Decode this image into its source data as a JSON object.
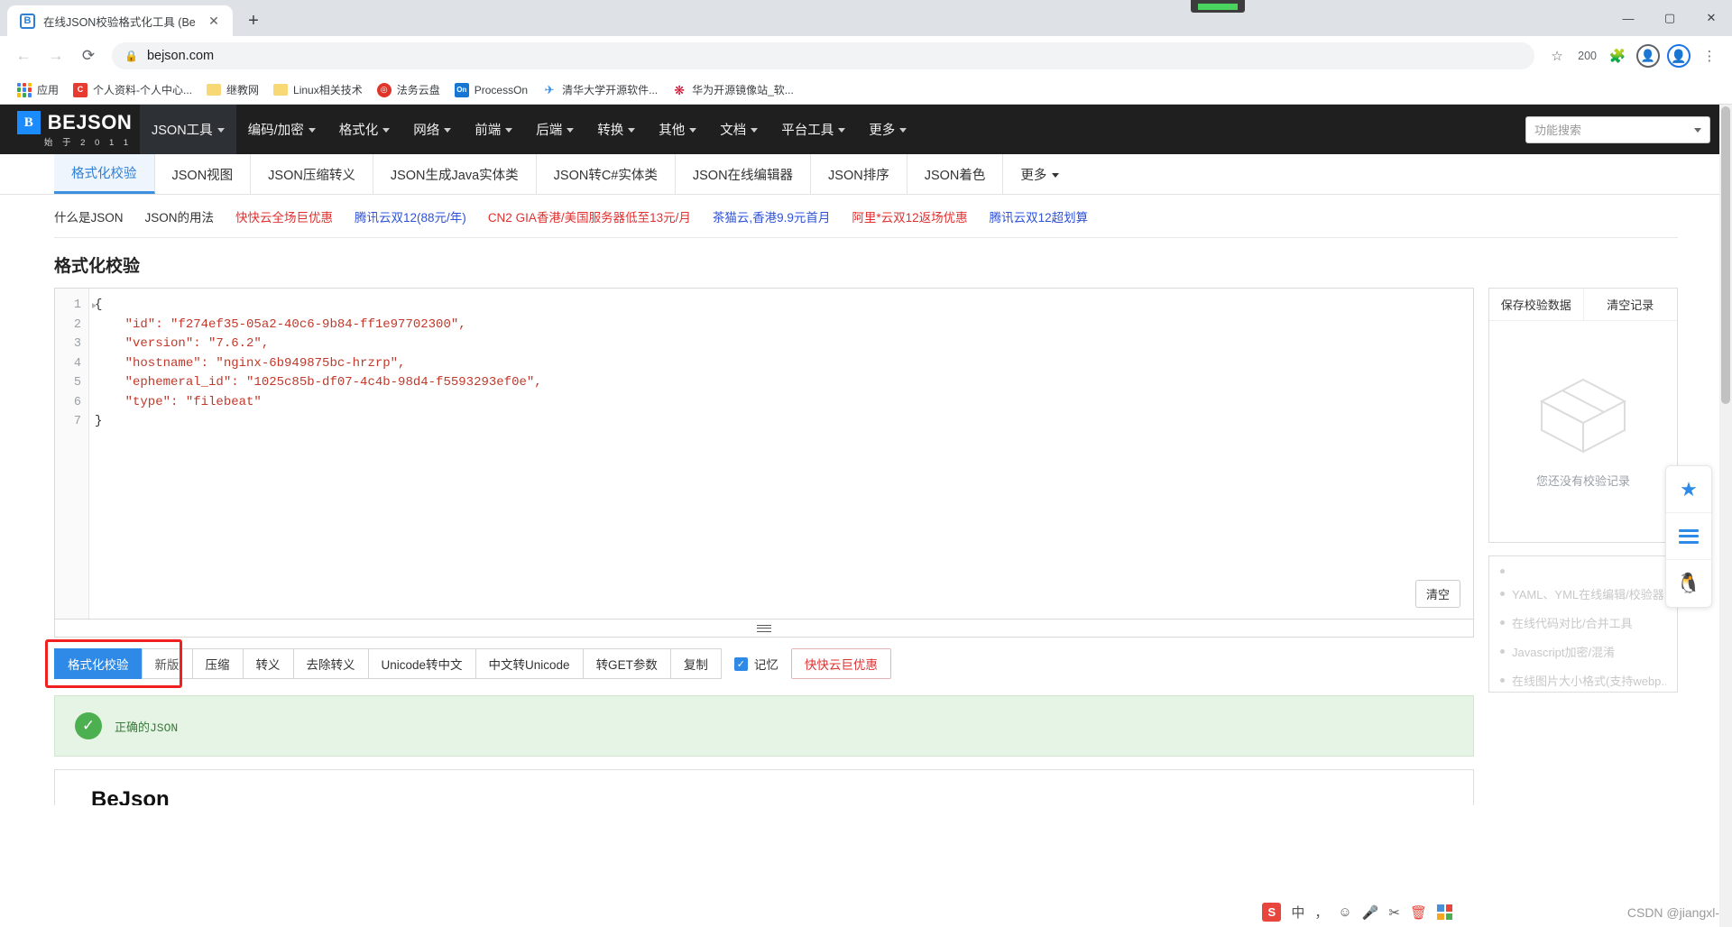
{
  "browser": {
    "tab": {
      "favicon_letter": "B",
      "title": "在线JSON校验格式化工具 (Be",
      "close_glyph": "✕"
    },
    "new_tab_glyph": "+",
    "nav": {
      "back_glyph": "←",
      "forward_glyph": "→",
      "reload_glyph": "⟳"
    },
    "omnibox": {
      "lock_glyph": "🔒",
      "url": "bejson.com",
      "star_glyph": "☆"
    },
    "extension_count": "200",
    "puzzle_glyph": "🧩",
    "profile_glyph": "👤",
    "menu_glyph": "⋮",
    "window_controls": {
      "minimize": "—",
      "maximize": "▢",
      "close": "✕"
    },
    "bookmarks": [
      {
        "label": "应用",
        "icon": "apps-grid-icon",
        "icon_letter": "",
        "color": ""
      },
      {
        "label": "个人资料-个人中心...",
        "icon": "csdn-icon",
        "icon_letter": "C",
        "color": "#e63b2e"
      },
      {
        "label": "继教网",
        "icon": "folder-icon",
        "icon_letter": "",
        "color": "#f8d775"
      },
      {
        "label": "Linux相关技术",
        "icon": "folder-icon",
        "icon_letter": "",
        "color": "#f8d775"
      },
      {
        "label": "法务云盘",
        "icon": "cloud-disk-icon",
        "icon_letter": "◎",
        "color": "#e0342a"
      },
      {
        "label": "ProcessOn",
        "icon": "processon-icon",
        "icon_letter": "On",
        "color": "#1677d2"
      },
      {
        "label": "清华大学开源软件...",
        "icon": "tsinghua-icon",
        "icon_letter": "✈",
        "color": "#2e8ae6"
      },
      {
        "label": "华为开源镜像站_软...",
        "icon": "huawei-icon",
        "icon_letter": "❋",
        "color": "#cf0a2c"
      }
    ]
  },
  "site": {
    "logo": {
      "mark": "B",
      "name": "BEJSON",
      "subtitle": "始 于 2 0 1 1"
    },
    "mainnav": [
      {
        "label": "JSON工具",
        "active": true
      },
      {
        "label": "编码/加密",
        "active": false
      },
      {
        "label": "格式化",
        "active": false
      },
      {
        "label": "网络",
        "active": false
      },
      {
        "label": "前端",
        "active": false
      },
      {
        "label": "后端",
        "active": false
      },
      {
        "label": "转换",
        "active": false
      },
      {
        "label": "其他",
        "active": false
      },
      {
        "label": "文档",
        "active": false
      },
      {
        "label": "平台工具",
        "active": false
      },
      {
        "label": "更多",
        "active": false
      }
    ],
    "search": {
      "placeholder": "功能搜索"
    },
    "subtabs": [
      {
        "label": "格式化校验",
        "active": true,
        "caret": false
      },
      {
        "label": "JSON视图",
        "active": false,
        "caret": false
      },
      {
        "label": "JSON压缩转义",
        "active": false,
        "caret": false
      },
      {
        "label": "JSON生成Java实体类",
        "active": false,
        "caret": false
      },
      {
        "label": "JSON转C#实体类",
        "active": false,
        "caret": false
      },
      {
        "label": "JSON在线编辑器",
        "active": false,
        "caret": false
      },
      {
        "label": "JSON排序",
        "active": false,
        "caret": false
      },
      {
        "label": "JSON着色",
        "active": false,
        "caret": false
      },
      {
        "label": "更多",
        "active": false,
        "caret": true
      }
    ],
    "promo_links": [
      {
        "label": "什么是JSON",
        "color": "#333333"
      },
      {
        "label": "JSON的用法",
        "color": "#333333"
      },
      {
        "label": "快快云全场巨优惠",
        "color": "#e03131"
      },
      {
        "label": "腾讯云双12(88元/年)",
        "color": "#2f52d8"
      },
      {
        "label": "CN2 GIA香港/美国服务器低至13元/月",
        "color": "#e03131"
      },
      {
        "label": "茶猫云,香港9.9元首月",
        "color": "#2f52d8"
      },
      {
        "label": "阿里*云双12返场优惠",
        "color": "#e03131"
      },
      {
        "label": "腾讯云双12超划算",
        "color": "#2f52d8"
      }
    ]
  },
  "main": {
    "page_title": "格式化校验",
    "editor": {
      "line_numbers": [
        "1",
        "2",
        "3",
        "4",
        "5",
        "6",
        "7"
      ],
      "lines": [
        "{",
        "    \"id\": \"f274ef35-05a2-40c6-9b84-ff1e97702300\",",
        "    \"version\": \"7.6.2\",",
        "    \"hostname\": \"nginx-6b949875bc-hrzrp\",",
        "    \"ephemeral_id\": \"1025c85b-df07-4c4b-98d4-f5593293ef0e\",",
        "    \"type\": \"filebeat\"",
        "}"
      ],
      "clear_label": "清空"
    },
    "actions": [
      {
        "label": "格式化校验",
        "style": "primary"
      },
      {
        "label": "新版",
        "style": "muted"
      },
      {
        "label": "压缩",
        "style": "normal"
      },
      {
        "label": "转义",
        "style": "normal"
      },
      {
        "label": "去除转义",
        "style": "normal"
      },
      {
        "label": "Unicode转中文",
        "style": "normal"
      },
      {
        "label": "中文转Unicode",
        "style": "normal"
      },
      {
        "label": "转GET参数",
        "style": "normal"
      },
      {
        "label": "复制",
        "style": "normal"
      }
    ],
    "memory_checkbox": {
      "label": "记忆",
      "checked": true,
      "glyph": "✓"
    },
    "promo_button": {
      "label": "快快云巨优惠"
    },
    "result": {
      "icon": "check-circle-icon",
      "glyph": "✓",
      "text": "正确的JSON"
    },
    "bottom_title": "BeJson"
  },
  "right_panel": {
    "save_label": "保存校验数据",
    "clear_label": "清空记录",
    "empty_message": "您还没有校验记录",
    "links": [
      "",
      "YAML、YML在线编辑/校验器",
      "在线代码对比/合并工具",
      "Javascript加密/混淆",
      "在线图片大小格式(支持webp..."
    ]
  },
  "rail": [
    {
      "name": "favorite-star-icon",
      "glyph": "★"
    },
    {
      "name": "menu-hamburger-icon",
      "glyph": ""
    },
    {
      "name": "qq-contact-icon",
      "glyph": "🐧"
    }
  ],
  "ime": {
    "logo": "S",
    "items": [
      "中",
      "，",
      "☺",
      "🎤",
      "✂",
      "🗑",
      ""
    ]
  },
  "watermark": "CSDN @jiangxl-"
}
